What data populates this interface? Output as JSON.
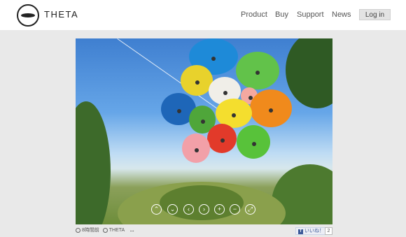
{
  "header": {
    "brand": "THETA",
    "nav": [
      "Product",
      "Buy",
      "Support",
      "News"
    ],
    "login_label": "Log in"
  },
  "viewer": {
    "controls": [
      {
        "name": "up-icon",
        "glyph": "⌃"
      },
      {
        "name": "down-icon",
        "glyph": "⌄"
      },
      {
        "name": "left-icon",
        "glyph": "‹"
      },
      {
        "name": "right-icon",
        "glyph": "›"
      },
      {
        "name": "zoom-in-icon",
        "glyph": "+"
      },
      {
        "name": "zoom-out-icon",
        "glyph": "−"
      },
      {
        "name": "fullscreen-icon",
        "glyph": "⤢"
      }
    ]
  },
  "footer": {
    "time_ago": "8時間前",
    "user": "THETA",
    "more": "...",
    "like_label": "いいね！",
    "like_count": "2"
  }
}
